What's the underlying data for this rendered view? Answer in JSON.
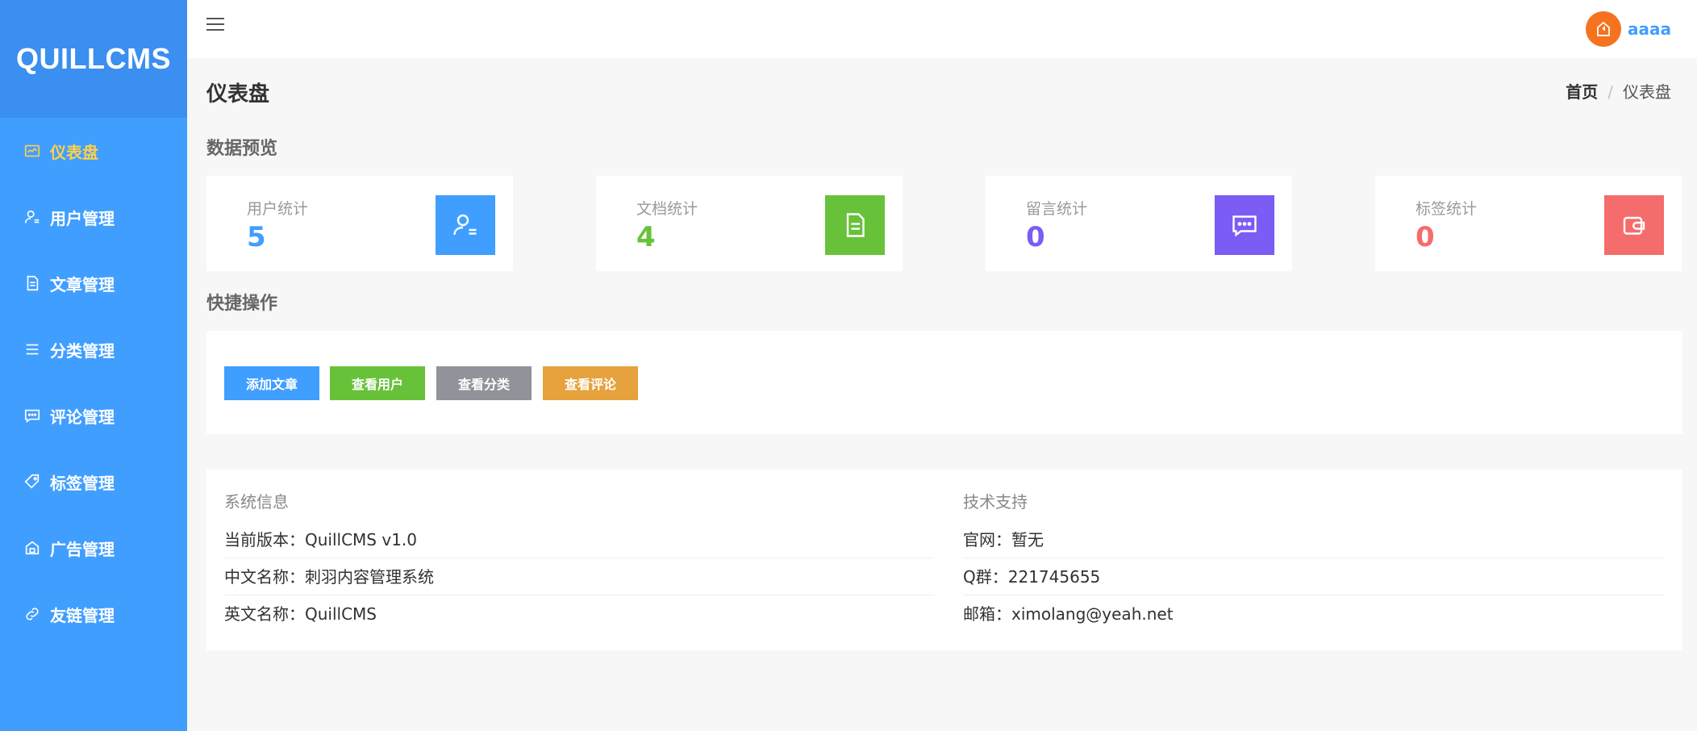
{
  "app": {
    "logo": "QUILLCMS"
  },
  "colors": {
    "primary": "#409eff",
    "success": "#67c23a",
    "info": "#909399",
    "warning": "#e6a23c",
    "purple": "#7b5cf5",
    "danger": "#f56c6c",
    "active_menu": "#ffd04b"
  },
  "sidebar": {
    "items": [
      {
        "label": "仪表盘",
        "icon": "dashboard-icon",
        "active": true
      },
      {
        "label": "用户管理",
        "icon": "user-icon"
      },
      {
        "label": "文章管理",
        "icon": "document-icon"
      },
      {
        "label": "分类管理",
        "icon": "list-icon"
      },
      {
        "label": "评论管理",
        "icon": "comment-icon"
      },
      {
        "label": "标签管理",
        "icon": "tag-icon"
      },
      {
        "label": "广告管理",
        "icon": "ad-icon"
      },
      {
        "label": "友链管理",
        "icon": "link-icon"
      }
    ]
  },
  "header": {
    "username": "aaaa"
  },
  "page": {
    "title": "仪表盘",
    "breadcrumb": {
      "home": "首页",
      "separator": "/",
      "current": "仪表盘"
    }
  },
  "overview": {
    "title": "数据预览",
    "cards": [
      {
        "label": "用户统计",
        "value": "5",
        "icon": "user-icon"
      },
      {
        "label": "文档统计",
        "value": "4",
        "icon": "document-icon"
      },
      {
        "label": "留言统计",
        "value": "0",
        "icon": "message-icon"
      },
      {
        "label": "标签统计",
        "value": "0",
        "icon": "wallet-icon"
      }
    ]
  },
  "quick": {
    "title": "快捷操作",
    "buttons": [
      {
        "label": "添加文章"
      },
      {
        "label": "查看用户"
      },
      {
        "label": "查看分类"
      },
      {
        "label": "查看评论"
      }
    ]
  },
  "system": {
    "title": "系统信息",
    "rows": [
      "当前版本：QuillCMS v1.0",
      "中文名称：刺羽内容管理系统",
      "英文名称：QuillCMS"
    ]
  },
  "support": {
    "title": "技术支持",
    "rows": [
      "官网：暂无",
      "Q群：221745655",
      "邮箱：ximolang@yeah.net"
    ]
  }
}
